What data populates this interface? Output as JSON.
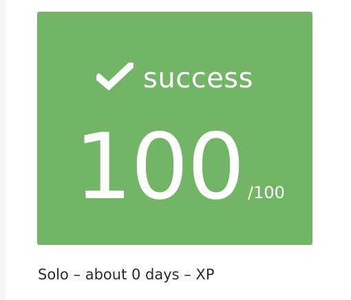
{
  "result": {
    "status_icon": "check-icon",
    "status_label": "success",
    "score": "100",
    "score_max": "/100",
    "accent_color": "#72b567"
  },
  "caption": "Solo – about 0 days – XP"
}
